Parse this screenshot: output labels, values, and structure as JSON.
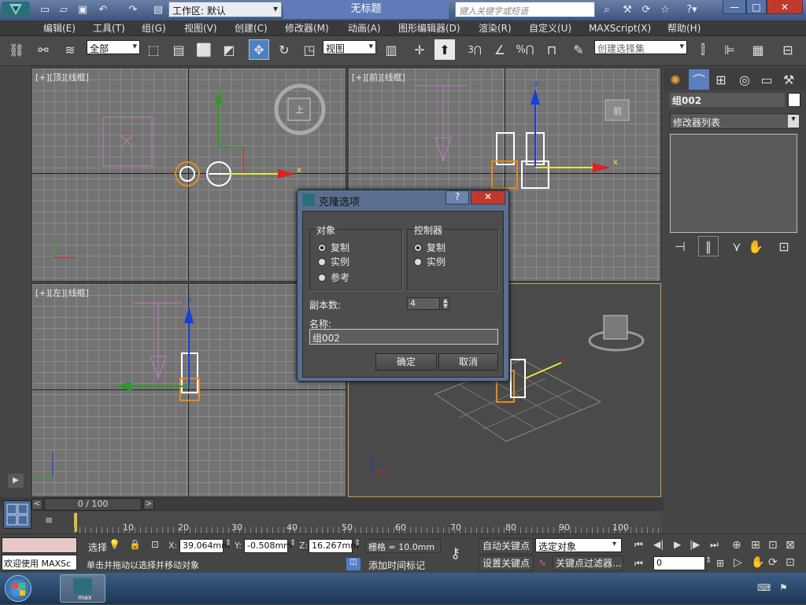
{
  "titlebar": {
    "workspace_label": "工作区: 默认",
    "doc_title": "无标题",
    "search_placeholder": "键入关键字或短语",
    "min": "—",
    "max": "□",
    "close": "✕"
  },
  "menu": [
    "编辑(E)",
    "工具(T)",
    "组(G)",
    "视图(V)",
    "创建(C)",
    "修改器(M)",
    "动画(A)",
    "图形编辑器(D)",
    "渲染(R)",
    "自定义(U)",
    "MAXScript(X)",
    "帮助(H)"
  ],
  "toolbar": {
    "filter_value": "全部",
    "refcoord_value": "视图",
    "selection_set_placeholder": "创建选择集",
    "snap_label": "3",
    "percent_label": "%"
  },
  "viewports": {
    "top": "[+][顶][线框]",
    "front": "[+][前][线框]",
    "left": "[+][左][线框]",
    "axis_x": "x",
    "axis_y": "y",
    "axis_z": "z",
    "cube_top": "上",
    "cube_front": "前"
  },
  "cmdpanel": {
    "object_name": "组002",
    "modifier_list": "修改器列表"
  },
  "dialog": {
    "title": "克隆选项",
    "help": "?",
    "close": "✕",
    "object_group": "对象",
    "object_options": [
      "复制",
      "实例",
      "参考"
    ],
    "controller_group": "控制器",
    "controller_options": [
      "复制",
      "实例"
    ],
    "copies_label": "副本数:",
    "copies_value": "4",
    "name_label": "名称:",
    "name_value": "组002",
    "ok": "确定",
    "cancel": "取消"
  },
  "timeline": {
    "frame": "0 / 100",
    "ticks": [
      "10",
      "20",
      "30",
      "40",
      "50",
      "60",
      "70",
      "80",
      "90",
      "100"
    ],
    "prev": "<",
    "next": ">"
  },
  "status": {
    "welcome": "欢迎使用 MAXSc",
    "select_label": "选择",
    "x_label": "X:",
    "x_value": "39.064mm",
    "y_label": "Y:",
    "y_value": "-0.508mm",
    "z_label": "Z:",
    "z_value": "16.267mm",
    "grid": "栅格 = 10.0mm",
    "autokey": "自动关键点",
    "setkey": "设置关键点",
    "selected": "选定对象",
    "keyfilter": "关键点过滤器...",
    "prompt": "单击并拖动以选择并移动对象",
    "add_time_tag": "添加时间标记",
    "frame_value": "0"
  },
  "taskbar": {
    "app_label": "max"
  }
}
